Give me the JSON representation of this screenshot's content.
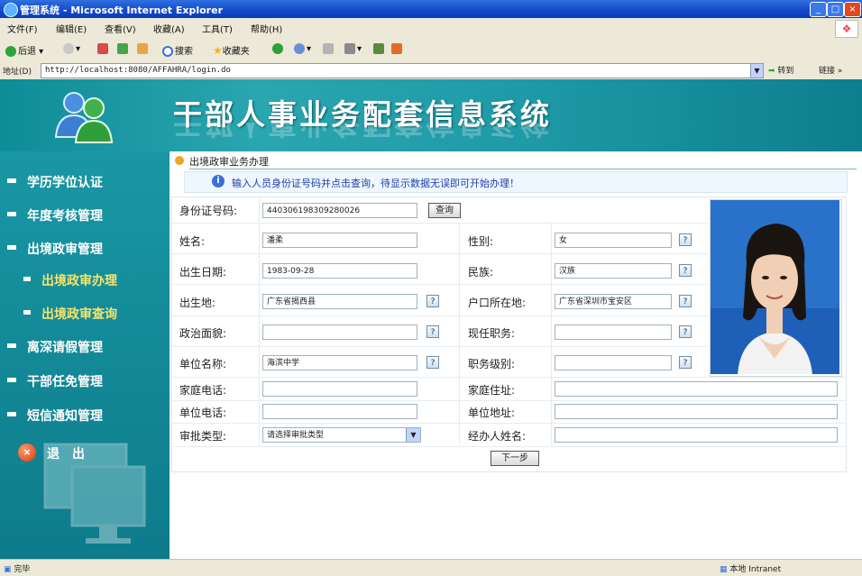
{
  "window": {
    "title": "管理系统 - Microsoft Internet Explorer",
    "controls": [
      "_",
      "□",
      "×"
    ]
  },
  "menubar": [
    "文件(F)",
    "编辑(E)",
    "查看(V)",
    "收藏(A)",
    "工具(T)",
    "帮助(H)"
  ],
  "toolbar": {
    "back": "后退",
    "search": "搜索",
    "favorites": "收藏夹"
  },
  "address": {
    "label": "地址(D)",
    "url": "http://localhost:8080/AFFAHRA/login.do",
    "go": "转到",
    "links": "链接 »"
  },
  "banner": {
    "title": "干部人事业务配套信息系统"
  },
  "sidebar": {
    "items": [
      {
        "label": "学历学位认证",
        "level": 1
      },
      {
        "label": "年度考核管理",
        "level": 1
      },
      {
        "label": "出境政审管理",
        "level": 1
      },
      {
        "label": "出境政审办理",
        "level": 2
      },
      {
        "label": "出境政审查询",
        "level": 2
      },
      {
        "label": "离深请假管理",
        "level": 1
      },
      {
        "label": "干部任免管理",
        "level": 1
      },
      {
        "label": "短信通知管理",
        "level": 1
      }
    ],
    "exit_label": "退出",
    "exit_icon": "×"
  },
  "page": {
    "crumb": "出境政审业务办理",
    "hint": "输入人员身份证号码并点击查询，待显示数据无误即可开始办理！",
    "hint_icon": "i"
  },
  "form": {
    "id_label": "身份证号码:",
    "id_value": "440306198309280026",
    "query_btn": "查询",
    "name_label": "姓名:",
    "name_value": "潘柔",
    "gender_label": "性别:",
    "gender_value": "女",
    "birth_label": "出生日期:",
    "birth_value": "1983-09-28",
    "ethnic_label": "民族:",
    "ethnic_value": "汉族",
    "birthplace_label": "出生地:",
    "birthplace_value": "广东省揭西县",
    "hukou_label": "户口所在地:",
    "hukou_value": "广东省深圳市宝安区",
    "political_label": "政治面貌:",
    "political_value": "",
    "position_label": "现任职务:",
    "position_value": "",
    "unit_label": "单位名称:",
    "unit_value": "海滨中学",
    "rank_label": "职务级别:",
    "rank_value": "",
    "homephone_label": "家庭电话:",
    "homephone_value": "",
    "homeaddr_label": "家庭住址:",
    "homeaddr_value": "",
    "unitphone_label": "单位电话:",
    "unitphone_value": "",
    "unitaddr_label": "单位地址:",
    "unitaddr_value": "",
    "approval_label": "审批类型:",
    "approval_value": "请选择审批类型",
    "handler_label": "经办人姓名:",
    "handler_value": "",
    "next_btn": "下一步",
    "help_glyph": "?"
  },
  "statusbar": {
    "left": "完毕",
    "zone": "本地 Intranet"
  }
}
